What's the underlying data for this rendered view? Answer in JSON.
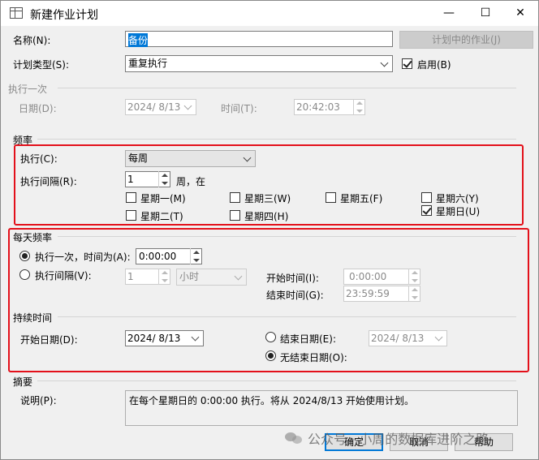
{
  "window": {
    "title": "新建作业计划",
    "minimize": "—",
    "maximize": "☐",
    "close": "✕"
  },
  "general": {
    "name_label": "名称(N):",
    "name_value": "备份",
    "jobs_in_schedule_button": "计划中的作业(J)",
    "schedule_type_label": "计划类型(S):",
    "schedule_type_value": "重复执行",
    "enabled_label": "启用(B)",
    "enabled_checked": true
  },
  "one_time": {
    "group_label": "执行一次",
    "date_label": "日期(D):",
    "date_value": "2024/ 8/13",
    "time_label": "时间(T):",
    "time_value": "20:42:03"
  },
  "frequency": {
    "group_label": "频率",
    "occurs_label": "执行(C):",
    "occurs_value": "每周",
    "interval_label": "执行间隔(R):",
    "interval_value": "1",
    "interval_suffix": "周，在",
    "days": [
      {
        "label": "星期一(M)",
        "checked": false
      },
      {
        "label": "星期二(T)",
        "checked": false
      },
      {
        "label": "星期三(W)",
        "checked": false
      },
      {
        "label": "星期四(H)",
        "checked": false
      },
      {
        "label": "星期五(F)",
        "checked": false
      },
      {
        "label": "星期六(Y)",
        "checked": false
      },
      {
        "label": "星期日(U)",
        "checked": true
      }
    ]
  },
  "daily_frequency": {
    "group_label": "每天频率",
    "once_label": "执行一次，时间为(A):",
    "once_value": "0:00:00",
    "once_selected": true,
    "every_label": "执行间隔(V):",
    "every_value": "1",
    "every_unit": "小时",
    "start_time_label": "开始时间(I):",
    "start_time_value": "0:00:00",
    "end_time_label": "结束时间(G):",
    "end_time_value": "23:59:59"
  },
  "duration": {
    "group_label": "持续时间",
    "start_date_label": "开始日期(D):",
    "start_date_value": "2024/ 8/13",
    "end_date_label": "结束日期(E):",
    "end_date_value": "2024/ 8/13",
    "no_end_date_label": "无结束日期(O):",
    "no_end_selected": true
  },
  "summary": {
    "group_label": "摘要",
    "description_label": "说明(P):",
    "description_value": "在每个星期日的 0:00:00 执行。将从 2024/8/13 开始使用计划。"
  },
  "buttons": {
    "ok": "确定",
    "cancel": "取消",
    "help": "帮助"
  },
  "watermark": "公众号 · 小周的数据库进阶之路",
  "colors": {
    "highlight_box": "#e3101a",
    "selection": "#0078d7"
  }
}
